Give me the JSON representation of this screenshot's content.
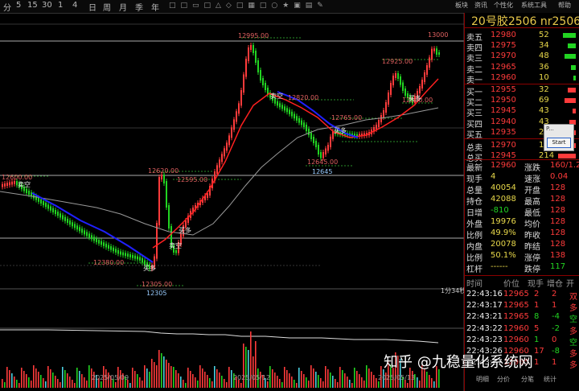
{
  "toolbar": {
    "timeframes": [
      "分",
      "5",
      "15",
      "30",
      "1",
      "4",
      "日",
      "周",
      "月",
      "季",
      "年"
    ],
    "menu": [
      "板块",
      "资讯",
      "个性化",
      "系统工具",
      "帮助"
    ]
  },
  "instrument": {
    "title": "20号胶2506  nr2506"
  },
  "orderbook": {
    "asks": [
      {
        "label": "卖五",
        "price": "12980",
        "vol": "52"
      },
      {
        "label": "卖四",
        "price": "12975",
        "vol": "34"
      },
      {
        "label": "卖三",
        "price": "12970",
        "vol": "48"
      },
      {
        "label": "卖二",
        "price": "12965",
        "vol": "36"
      },
      {
        "label": "卖一",
        "price": "12960",
        "vol": "10"
      }
    ],
    "bids": [
      {
        "label": "买一",
        "price": "12955",
        "vol": "32"
      },
      {
        "label": "买二",
        "price": "12950",
        "vol": "69"
      },
      {
        "label": "买三",
        "price": "12945",
        "vol": "43"
      },
      {
        "label": "买四",
        "price": "12940",
        "vol": "43"
      },
      {
        "label": "买五",
        "price": "12935",
        "vol": "2"
      }
    ],
    "totals": [
      {
        "label": "总卖",
        "price": "12970",
        "vol": "18"
      },
      {
        "label": "总买",
        "price": "12945",
        "vol": "214"
      }
    ]
  },
  "stats": [
    {
      "l1": "最新",
      "v1": "12960",
      "l2": "涨跌",
      "v2": "160/1.25"
    },
    {
      "l1": "现手",
      "v1": "4",
      "l2": "速涨",
      "v2": "0.04"
    },
    {
      "l1": "总量",
      "v1": "40054",
      "l2": "开盘",
      "v2": "128"
    },
    {
      "l1": "持仓",
      "v1": "42088",
      "l2": "最高",
      "v2": "128"
    },
    {
      "l1": "日增",
      "v1": "-810",
      "l2": "最低",
      "v2": "128"
    },
    {
      "l1": "外盘",
      "v1": "19976",
      "l2": "均价",
      "v2": "128"
    },
    {
      "l1": "比例",
      "v1": "49.9%",
      "l2": "昨收",
      "v2": "128"
    },
    {
      "l1": "内盘",
      "v1": "20078",
      "l2": "昨结",
      "v2": "128"
    },
    {
      "l1": "比例",
      "v1": "50.1%",
      "l2": "涨停",
      "v2": "138"
    },
    {
      "l1": "杠杆",
      "v1": "------",
      "l2": "跌停",
      "v2": "117"
    }
  ],
  "ticks": {
    "headers": [
      "时间",
      "价位",
      "现手",
      "增仓",
      "开"
    ],
    "rows": [
      {
        "time": "22:43:16",
        "price": "12965",
        "qty": "2",
        "chg": "2",
        "type": "双"
      },
      {
        "time": "22:43:17",
        "price": "12965",
        "qty": "1",
        "chg": "1",
        "type": "多"
      },
      {
        "time": "22:43:21",
        "price": "12965",
        "qty": "8",
        "chg": "-4",
        "type": "空"
      },
      {
        "time": "22:43:22",
        "price": "12960",
        "qty": "5",
        "chg": "-2",
        "type": "多"
      },
      {
        "time": "22:43:23",
        "price": "12960",
        "qty": "1",
        "chg": "0",
        "type": "空"
      },
      {
        "time": "22:43:26",
        "price": "12960",
        "qty": "17",
        "chg": "-8",
        "type": "多"
      },
      {
        "time": "22:43:27",
        "price": "12965",
        "qty": "1",
        "chg": "1",
        "type": "多"
      }
    ],
    "footer_buttons": [
      "明细",
      "分价",
      "分笔",
      "统计"
    ]
  },
  "chart_labels": {
    "high_top": "12995.00",
    "high_right": "13000",
    "p12925": "12925.00",
    "p12820": "12820.00",
    "p12765": "12765.00",
    "p12645a": "12645.00",
    "p12645b": "12645",
    "p12620": "12620.00",
    "p12595": "12595.00",
    "p12600": "12600.00",
    "p12380": "12380.00",
    "p12305a": "12305.00",
    "p12305b": "12305",
    "p12840": "12840.00",
    "sig_long1": "买多",
    "sig_short1": "卖空",
    "sig_short2": "卖空",
    "sig_long2": "买多",
    "sig_long3": "买多",
    "sig_short3": "卖空",
    "sig_long4": "买多",
    "period": "1分34秒"
  },
  "dates": [
    "2025/05/09",
    "2025/05/12",
    "2025/05/13"
  ],
  "watermark": "知乎 @九稳量化系统网",
  "popup": {
    "title": "P...",
    "button": "Start"
  },
  "colors": {
    "up": "#ff3b3b",
    "down": "#22d422",
    "ma_fast": "#ff2020",
    "ma_slow": "#999999",
    "trend_down": "#2020ff"
  }
}
